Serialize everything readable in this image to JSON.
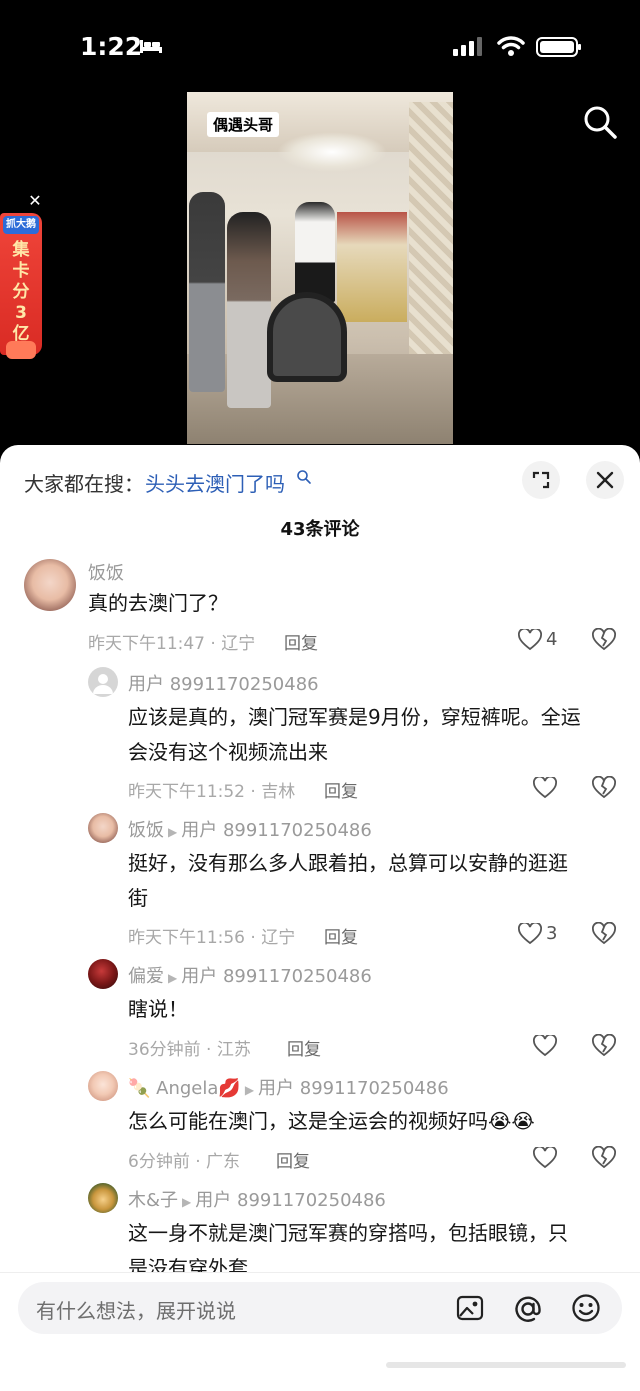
{
  "status_bar": {
    "time": "1:22"
  },
  "video": {
    "tag": "偶遇头哥"
  },
  "promo": {
    "badge": "抓大鹅",
    "text": "集卡分3亿"
  },
  "sheet": {
    "trending_prefix": "大家都在搜：",
    "trending_link": "头头去澳门了吗",
    "comment_count": "43条评论"
  },
  "comments": [
    {
      "name": "饭饭",
      "text": "真的去澳门了？",
      "meta": "昨天下午11:47 · 辽宁",
      "reply": "回复",
      "likes": "4"
    },
    {
      "name": "用户 8991170250486",
      "text_line1": "应该是真的，澳门冠军赛是9月份，穿短裤呢。全运",
      "text_line2": "会没有这个视频流出来",
      "meta": "昨天下午11:52 · 吉林",
      "reply": "回复"
    },
    {
      "name": "饭饭",
      "reply_to": "用户 8991170250486",
      "text_line1": "挺好，没有那么多人跟着拍，总算可以安静的逛逛",
      "text_line2": "街",
      "meta": "昨天下午11:56 · 辽宁",
      "reply": "回复",
      "likes": "3"
    },
    {
      "name": "偏爱",
      "reply_to": "用户 8991170250486",
      "text": "瞎说！",
      "meta": "36分钟前 · 江苏",
      "reply": "回复"
    },
    {
      "name": "🍡 Angela💋",
      "reply_to": "用户 8991170250486",
      "text": "怎么可能在澳门，这是全运会的视频好吗😭😭",
      "meta": "6分钟前 · 广东",
      "reply": "回复"
    },
    {
      "name": "木&子",
      "reply_to": "用户 8991170250486",
      "text_line1": "这一身不就是澳门冠军赛的穿搭吗，包括眼镜，只",
      "text_line2": "是没有穿外套"
    }
  ],
  "input": {
    "placeholder": "有什么想法，展开说说"
  },
  "colors": {
    "link": "#2d5fb6",
    "sheet_bg": "#ffffff",
    "muted": "#a8a8a8"
  }
}
